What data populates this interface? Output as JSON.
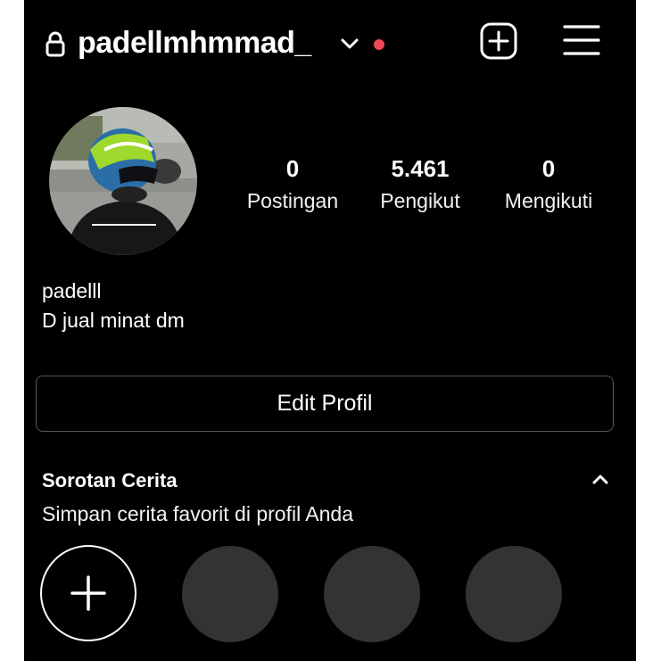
{
  "header": {
    "username": "padellmhmmad_",
    "icons": {
      "lock": "lock-icon",
      "chevron": "chevron-down-icon",
      "add_post": "plus-square-icon",
      "menu": "hamburger-menu-icon"
    },
    "notification_dot_color": "#ed4956"
  },
  "profile": {
    "avatar": "profile-photo-helmet",
    "stats": [
      {
        "value": "0",
        "label": "Postingan"
      },
      {
        "value": "5.461",
        "label": "Pengikut"
      },
      {
        "value": "0",
        "label": "Mengikuti"
      }
    ],
    "display_name": "padelll",
    "bio": "D jual minat dm",
    "edit_button_label": "Edit Profil"
  },
  "highlights": {
    "title": "Sorotan Cerita",
    "subtitle": "Simpan cerita favorit di profil Anda",
    "collapse_icon": "chevron-up-icon",
    "new_icon": "plus-icon",
    "placeholder_color": "#333333"
  },
  "colors": {
    "background": "#000000",
    "text": "#ffffff",
    "border": "#5a5a5a"
  }
}
